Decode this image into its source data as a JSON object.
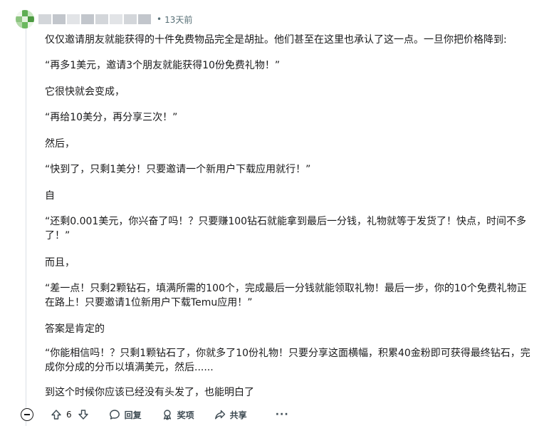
{
  "comment": {
    "timestamp": "13天前",
    "separator": "•",
    "paragraphs": [
      "仅仅邀请朋友就能获得的十件免费物品完全是胡扯。他们甚至在这里也承认了这一点。一旦你把价格降到:",
      "“再多1美元，邀请3个朋友就能获得10份免费礼物！”",
      "它很快就会变成，",
      "“再给10美分，再分享三次！”",
      "然后，",
      "“快到了，只剩1美分！只要邀请一个新用户下载应用就行！”",
      "自",
      "“还剩0.001美元，你兴奋了吗！？只要赚100钻石就能拿到最后一分钱，礼物就等于发货了！快点，时间不多了！”",
      "而且，",
      "“差一点！只剩2颗钻石，填满所需的100个，完成最后一分钱就能领取礼物！最后一步，你的10个免费礼物正在路上！只要邀请1位新用户下载Temu应用！”",
      "答案是肯定的",
      "“你能相信吗！？只剩1颗钻石了，你就多了10份礼物！只要分享这面横幅，积累40金粉即可获得最终钻石，完成你分成的分币以填满美元，然后......",
      "到这个时候你应该已经没有头发了，也能明白了"
    ]
  },
  "actions": {
    "vote_count": "6",
    "reply_label": "回复",
    "award_label": "奖项",
    "share_label": "共享",
    "more_label": "···"
  },
  "colors": {
    "meta_text": "#576f76",
    "body_text": "#1a1a1b",
    "thread_line": "#dbe0e6"
  }
}
